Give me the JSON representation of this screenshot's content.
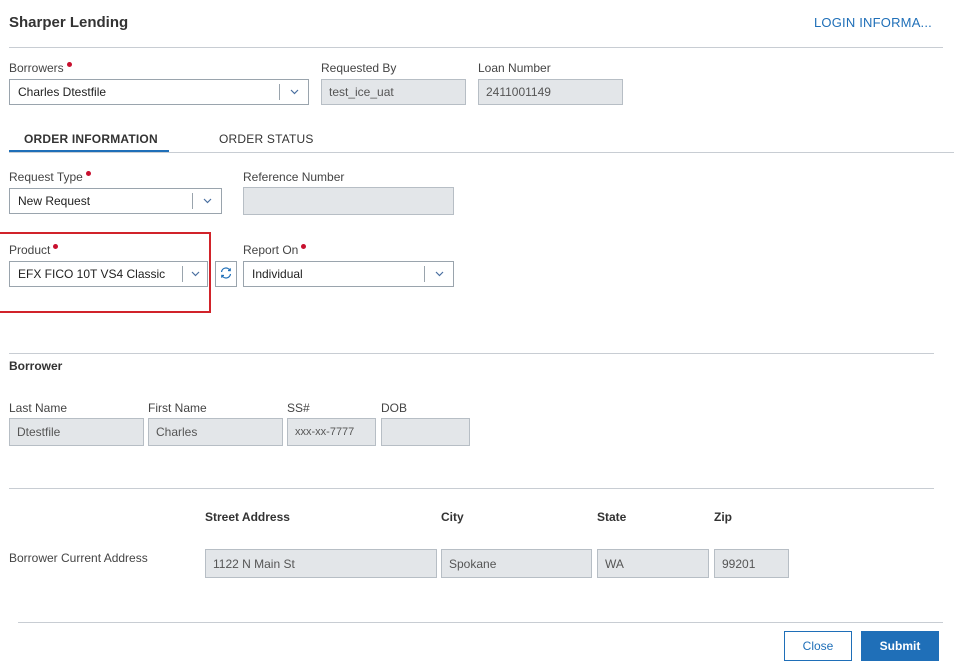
{
  "app": {
    "title": "Sharper Lending",
    "login_link": "LOGIN INFORMA..."
  },
  "header_fields": {
    "borrowers": {
      "label": "Borrowers",
      "value": "Charles Dtestfile"
    },
    "requested_by": {
      "label": "Requested By",
      "value": "test_ice_uat"
    },
    "loan_number": {
      "label": "Loan Number",
      "value": "2411001149"
    }
  },
  "tabs": [
    {
      "label": "ORDER INFORMATION",
      "active": true
    },
    {
      "label": "ORDER STATUS",
      "active": false
    }
  ],
  "order_info": {
    "request_type": {
      "label": "Request Type",
      "value": "New Request"
    },
    "reference_number": {
      "label": "Reference Number",
      "value": ""
    },
    "product": {
      "label": "Product",
      "value": "EFX FICO 10T VS4 Classic"
    },
    "report_on": {
      "label": "Report On",
      "value": "Individual"
    }
  },
  "borrower": {
    "section_title": "Borrower",
    "last_name": {
      "label": "Last Name",
      "value": "Dtestfile"
    },
    "first_name": {
      "label": "First Name",
      "value": "Charles"
    },
    "ssn": {
      "label": "SS#",
      "value": "xxx-xx-7777"
    },
    "dob": {
      "label": "DOB",
      "value": ""
    }
  },
  "address": {
    "row_label": "Borrower Current Address",
    "headers": {
      "street": "Street Address",
      "city": "City",
      "state": "State",
      "zip": "Zip"
    },
    "street": "1122 N Main St",
    "city": "Spokane",
    "state": "WA",
    "zip": "99201"
  },
  "footer": {
    "close_label": "Close",
    "submit_label": "Submit"
  },
  "colors": {
    "accent": "#1f6fb8",
    "required": "#c8102e",
    "highlight": "#d1232a"
  },
  "icons": {
    "dropdown": "chevron-down-icon",
    "refresh": "refresh-icon"
  }
}
